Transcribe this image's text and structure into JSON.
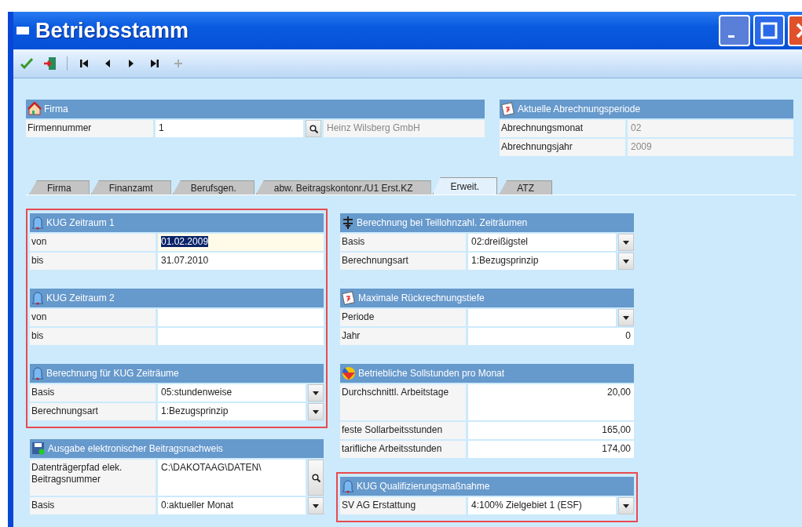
{
  "window": {
    "title": "Betriebsstamm"
  },
  "toolbar": [
    [
      {
        "kind": "save",
        "disabled": false
      },
      {
        "kind": "exit",
        "disabled": false
      }
    ],
    [
      {
        "kind": "first",
        "disabled": false
      },
      {
        "kind": "prev",
        "disabled": false
      },
      {
        "kind": "next",
        "disabled": false
      },
      {
        "kind": "last",
        "disabled": false
      },
      {
        "kind": "add",
        "disabled": true
      }
    ]
  ],
  "firma": {
    "title": "Firma",
    "kind": "house",
    "label": "Firmennummer",
    "value": "1",
    "name": "Heinz Wilsberg GmbH"
  },
  "period": {
    "title": "Aktuelle Abrechnungsperiode",
    "kind": "calendar",
    "rows": [
      {
        "label": "Abrechnungsmonat",
        "value": "02"
      },
      {
        "label": "Abrechnungsjahr",
        "value": "2009"
      }
    ]
  },
  "tabs": [
    {
      "label": "Firma",
      "selected": false
    },
    {
      "label": "Finanzamt",
      "selected": false
    },
    {
      "label": "Berufsgen.",
      "selected": false
    },
    {
      "label": "abw. Beitragskontonr./U1 Erst.KZ",
      "selected": false
    },
    {
      "label": "Erweit.",
      "selected": true
    },
    {
      "label": "ATZ",
      "selected": false
    }
  ],
  "columns": [
    [
      {
        "highlighted": true,
        "panels": [
          {
            "title": "KUG Zeitraum 1",
            "kind": "bell",
            "rows": [
              {
                "kind": "text",
                "label": "von",
                "value": "01.02.2009",
                "focused": true
              },
              {
                "kind": "text",
                "label": "bis",
                "value": "31.07.2010",
                "focused": false
              }
            ]
          },
          {
            "title": "KUG Zeitraum 2",
            "kind": "bell",
            "rows": [
              {
                "kind": "text",
                "label": "von",
                "focused": false
              },
              {
                "kind": "text",
                "label": "bis",
                "focused": false
              }
            ]
          },
          {
            "title": "Berechnung für KUG Zeiträume",
            "kind": "bell",
            "rows": [
              {
                "kind": "select",
                "label": "Basis",
                "value": "05:stundenweise",
                "focused": false
              },
              {
                "kind": "select",
                "label": "Berechnungsart",
                "value": "1:Bezugsprinzip",
                "focused": false
              }
            ]
          }
        ]
      },
      {
        "highlighted": false,
        "panels": [
          {
            "title": "Ausgabe elektronischer Beitragsnachweis",
            "kind": "floppy",
            "rows": [
              {
                "kind": "lookup",
                "label": "Datenträgerpfad elek. Beitragsnummer",
                "value": "C:\\DAKOTAAG\\DATEN\\",
                "focused": false
              },
              {
                "kind": "select",
                "label": "Basis",
                "value": "0:aktueller Monat",
                "focused": false
              }
            ]
          }
        ]
      }
    ],
    [
      {
        "highlighted": false,
        "panels": [
          {
            "title": "Berechnung bei Teillohnzahl. Zeiträumen",
            "kind": "scale",
            "rows": [
              {
                "kind": "select",
                "label": "Basis",
                "value": "02:dreißigstel",
                "focused": false
              },
              {
                "kind": "select",
                "label": "Berechnungsart",
                "value": "1:Bezugsprinzip",
                "focused": false
              }
            ]
          },
          {
            "title": "Maximale Rückrechnungstiefe",
            "kind": "calendar",
            "rows": [
              {
                "kind": "select",
                "label": "Periode",
                "focused": false
              },
              {
                "kind": "number",
                "label": "Jahr",
                "value": "0",
                "focused": false
              }
            ]
          },
          {
            "title": "Betriebliche Sollstunden pro Monat",
            "kind": "ball",
            "rows": [
              {
                "kind": "number",
                "label": "Durchschnittl. Arbeitstage",
                "value": "20,00",
                "focused": false,
                "tall": true
              },
              {
                "kind": "number",
                "label": "feste Sollarbeitsstunden",
                "value": "165,00",
                "focused": false
              },
              {
                "kind": "number",
                "label": "tarifliche Arbeitsstunden",
                "value": "174,00",
                "focused": false
              }
            ]
          }
        ]
      },
      {
        "highlighted": true,
        "panels": [
          {
            "title": "KUG Qualifizierungsmaßnahme",
            "kind": "bell",
            "rows": [
              {
                "kind": "select",
                "label": "SV AG Erstattung",
                "value": "4:100% Zielgebiet 1 (ESF)",
                "focused": false
              }
            ]
          }
        ]
      }
    ]
  ]
}
